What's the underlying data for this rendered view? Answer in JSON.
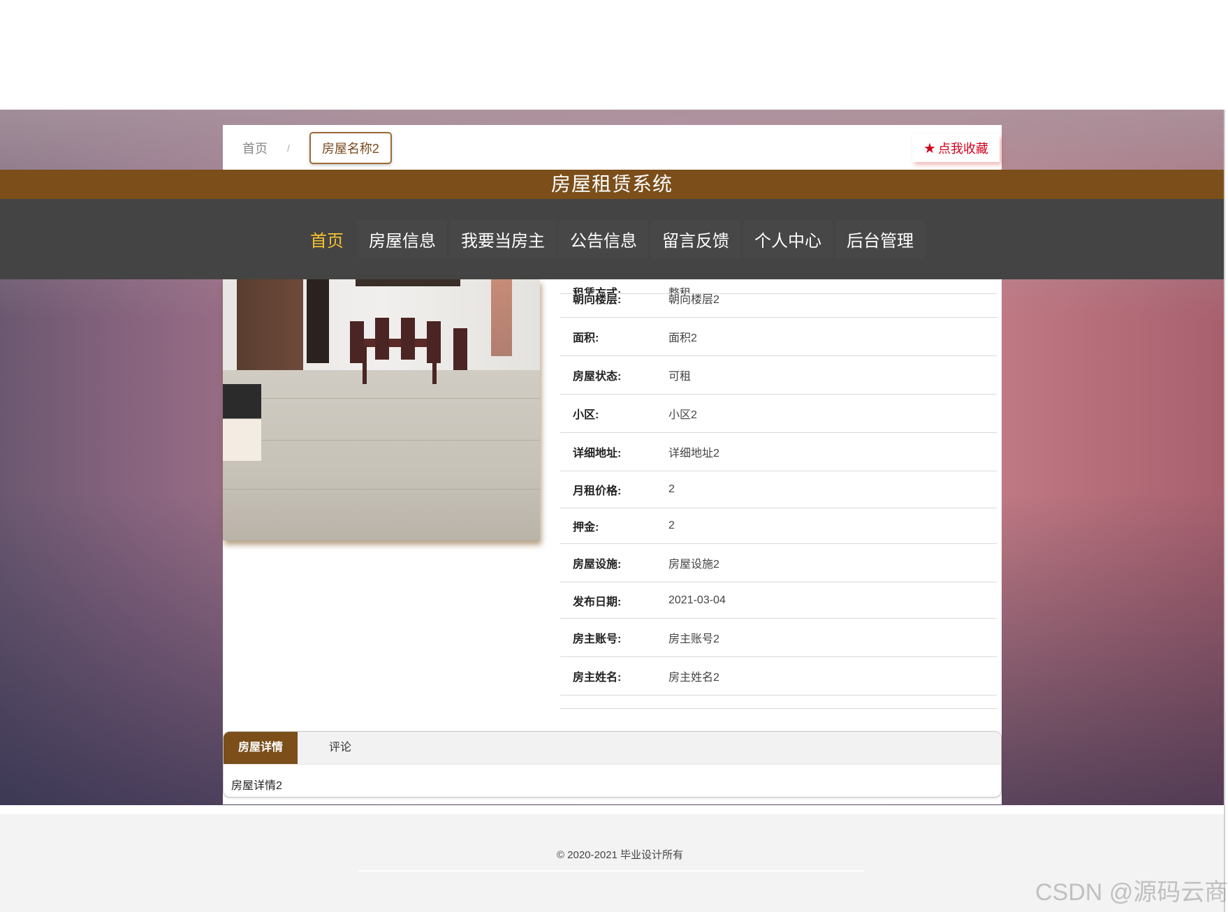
{
  "breadcrumb": {
    "home": "首页",
    "separator": "/",
    "current": "房屋名称2"
  },
  "favorite": {
    "icon": "star-icon",
    "label": "点我收藏",
    "color": "#d4001c"
  },
  "site_title": "房屋租赁系统",
  "nav": {
    "items": [
      {
        "label": "首页",
        "active": true
      },
      {
        "label": "房屋信息"
      },
      {
        "label": "我要当房主"
      },
      {
        "label": "公告信息"
      },
      {
        "label": "留言反馈"
      },
      {
        "label": "个人中心"
      },
      {
        "label": "后台管理"
      }
    ],
    "active_color": "#f5c230"
  },
  "details": {
    "partial_row": {
      "label": "租赁方式:",
      "value": "整租"
    },
    "rows": [
      {
        "label": "朝向楼层:",
        "value": "朝向楼层2"
      },
      {
        "label": "面积:",
        "value": "面积2"
      },
      {
        "label": "房屋状态:",
        "value": "可租"
      },
      {
        "label": "小区:",
        "value": "小区2"
      },
      {
        "label": "详细地址:",
        "value": "详细地址2"
      },
      {
        "label": "月租价格:",
        "value": "2"
      },
      {
        "label": "押金:",
        "value": "2"
      },
      {
        "label": "房屋设施:",
        "value": "房屋设施2"
      },
      {
        "label": "发布日期:",
        "value": "2021-03-04"
      },
      {
        "label": "房主账号:",
        "value": "房主账号2"
      },
      {
        "label": "房主姓名:",
        "value": "房主姓名2"
      }
    ]
  },
  "tabs": {
    "items": [
      {
        "label": "房屋详情",
        "active": true
      },
      {
        "label": "评论"
      }
    ],
    "content": "房屋详情2"
  },
  "footer": {
    "copyright": "© 2020-2021 毕业设计所有"
  },
  "watermark": "CSDN @源码云商",
  "colors": {
    "brand": "#7b4e1a",
    "navbar": "#444444"
  }
}
